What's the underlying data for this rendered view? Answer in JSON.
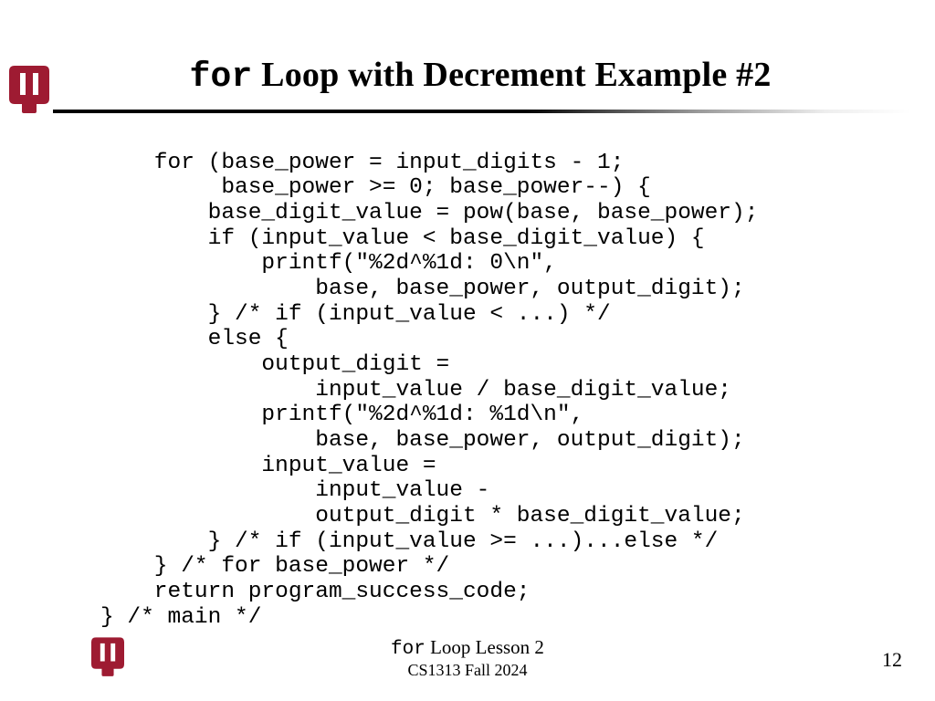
{
  "logo_color": "#9e1b32",
  "title": {
    "mono": "for",
    "rest": " Loop with Decrement Example #2"
  },
  "code": "    for (base_power = input_digits - 1;\n         base_power >= 0; base_power--) {\n        base_digit_value = pow(base, base_power);\n        if (input_value < base_digit_value) {\n            printf(\"%2d^%1d: 0\\n\",\n                base, base_power, output_digit);\n        } /* if (input_value < ...) */\n        else {\n            output_digit =\n                input_value / base_digit_value;\n            printf(\"%2d^%1d: %1d\\n\",\n                base, base_power, output_digit);\n            input_value =\n                input_value -\n                output_digit * base_digit_value;\n        } /* if (input_value >= ...)...else */\n    } /* for base_power */\n    return program_success_code;\n} /* main */",
  "footer": {
    "mono": "for",
    "rest": " Loop Lesson 2",
    "sub": "CS1313 Fall 2024"
  },
  "page_number": "12"
}
